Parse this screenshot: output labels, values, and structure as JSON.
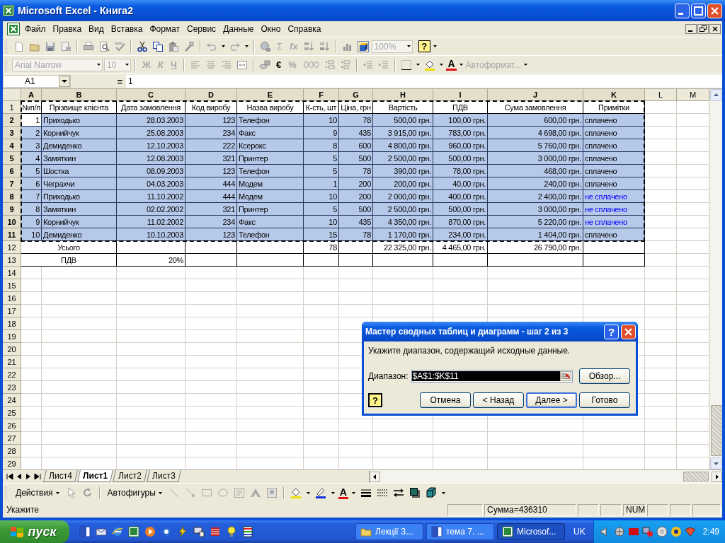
{
  "window": {
    "title": "Microsoft Excel - Книга2"
  },
  "menu": [
    "Файл",
    "Правка",
    "Вид",
    "Вставка",
    "Формат",
    "Сервис",
    "Данные",
    "Окно",
    "Справка"
  ],
  "standard_toolbar": {
    "sum": {
      "text": "Σ",
      "disabled": true
    },
    "function": {
      "text": "fx",
      "disabled": true
    },
    "zoom": {
      "text": "100%",
      "disabled": true
    },
    "help": "?"
  },
  "formatting_toolbar": {
    "font": {
      "text": "Arial Narrow",
      "disabled": true
    },
    "size": {
      "text": "10",
      "disabled": true
    },
    "bold": {
      "text": "Ж",
      "disabled": true
    },
    "italic": {
      "text": "К",
      "disabled": true
    },
    "underline": {
      "text": "Ч",
      "disabled": true
    },
    "euro": {
      "text": "€",
      "disabled": false
    },
    "percent": {
      "text": "%",
      "disabled": true
    },
    "thousands": {
      "text": "000",
      "disabled": true
    },
    "font_color": {
      "text": "A",
      "disabled": false
    },
    "autoformat": {
      "text": "Автоформат...",
      "disabled": true
    }
  },
  "formula_bar": {
    "name_box": "A1",
    "equals": "=",
    "value": "1"
  },
  "sheet": {
    "columns": [
      {
        "label": "A",
        "selected": true
      },
      {
        "label": "B",
        "selected": true
      },
      {
        "label": "C",
        "selected": true
      },
      {
        "label": "D",
        "selected": true
      },
      {
        "label": "E",
        "selected": true
      },
      {
        "label": "F",
        "selected": true
      },
      {
        "label": "G",
        "selected": true
      },
      {
        "label": "H",
        "selected": true
      },
      {
        "label": "I",
        "selected": true
      },
      {
        "label": "J",
        "selected": true
      },
      {
        "label": "K",
        "selected": true
      },
      {
        "label": "L",
        "selected": false
      },
      {
        "label": "M",
        "selected": false
      }
    ],
    "rows": [
      {
        "number": "1",
        "kind": "header",
        "selected": false,
        "cells": [
          "№п/п",
          "Прізвище клієнта",
          "Дата замовлення",
          "Код виробу",
          "Назва виробу",
          "К-сть, шт",
          "Ціна, грн",
          "Вартість",
          "ПДВ",
          "Сума замовлення",
          "Примітки"
        ]
      },
      {
        "number": "2",
        "kind": "data",
        "selected": true,
        "cells": [
          {
            "text": "1",
            "active": true
          },
          "Приходько",
          "28.03.2003",
          "123",
          "Телефон",
          "10",
          "78",
          "500,00 грн.",
          "100,00 грн.",
          "600,00 грн.",
          "сплачено"
        ]
      },
      {
        "number": "3",
        "kind": "data",
        "selected": true,
        "cells": [
          "2",
          "Корнийчук",
          "25.08.2003",
          "234",
          "Факс",
          "9",
          "435",
          "3 915,00 грн.",
          "783,00 грн.",
          "4 698,00 грн.",
          "сплачено"
        ]
      },
      {
        "number": "4",
        "kind": "data",
        "selected": true,
        "cells": [
          "3",
          "Демиденко",
          "12.10.2003",
          "222",
          "Ксерокс",
          "8",
          "600",
          "4 800,00 грн.",
          "960,00 грн.",
          "5 760,00 грн.",
          "сплачено"
        ]
      },
      {
        "number": "5",
        "kind": "data",
        "selected": true,
        "cells": [
          "4",
          "Замяткин",
          "12.08.2003",
          "321",
          "Принтер",
          "5",
          "500",
          "2 500,00 грн.",
          "500,00 грн.",
          "3 000,00 грн.",
          "сплачено"
        ]
      },
      {
        "number": "6",
        "kind": "data",
        "selected": true,
        "cells": [
          "5",
          "Шостка",
          "08.09.2003",
          "123",
          "Телефон",
          "5",
          "78",
          "390,00 грн.",
          "78,00 грн.",
          "468,00 грн.",
          "сплачено"
        ]
      },
      {
        "number": "7",
        "kind": "data",
        "selected": true,
        "cells": [
          "6",
          "Чеграхчи",
          "04.03.2003",
          "444",
          "Модем",
          "1",
          "200",
          "200,00 грн.",
          "40,00 грн.",
          "240,00 грн.",
          "сплачено"
        ]
      },
      {
        "number": "8",
        "kind": "data",
        "selected": true,
        "cells": [
          "7",
          "Приходько",
          "11.10.2002",
          "444",
          "Модем",
          "10",
          "200",
          "2 000,00 грн.",
          "400,00 грн.",
          "2 400,00 грн.",
          {
            "text": "не сплачено",
            "color": "#0000ff"
          }
        ]
      },
      {
        "number": "9",
        "kind": "data",
        "selected": true,
        "cells": [
          "8",
          "Замяткин",
          "02.02.2002",
          "321",
          "Принтер",
          "5",
          "500",
          "2 500,00 грн.",
          "500,00 грн.",
          "3 000,00 грн.",
          {
            "text": "не сплачено",
            "color": "#0000ff"
          }
        ]
      },
      {
        "number": "10",
        "kind": "data",
        "selected": true,
        "cells": [
          "9",
          "Корнийчук",
          "11.02.2002",
          "234",
          "Факс",
          "10",
          "435",
          "4 350,00 грн.",
          "870,00 грн.",
          "5 220,00 грн.",
          {
            "text": "не сплачено",
            "color": "#0000ff"
          }
        ]
      },
      {
        "number": "11",
        "kind": "data",
        "selected": true,
        "cells": [
          "10",
          "Демиденко",
          "10.10.2003",
          "123",
          "Телефон",
          "15",
          "78",
          "1 170,00 грн.",
          "234,00 грн.",
          "1 404,00 грн.",
          "сплачено"
        ]
      },
      {
        "number": "12",
        "kind": "total",
        "selected": false,
        "cells": [
          {
            "text": "Усього",
            "merged": true
          },
          null,
          null,
          null,
          "78",
          null,
          "22 325,00 грн.",
          "4 465,00 грн.",
          "26 790,00 грн.",
          null
        ]
      },
      {
        "number": "13",
        "kind": "total",
        "selected": false,
        "cells": [
          {
            "text": "ПДВ",
            "merged": true
          },
          "20%",
          null,
          null,
          null,
          null,
          null,
          null,
          null,
          null
        ]
      },
      {
        "number": "14",
        "kind": "empty",
        "selected": false
      },
      {
        "number": "15",
        "kind": "empty",
        "selected": false
      },
      {
        "number": "16",
        "kind": "empty",
        "selected": false
      },
      {
        "number": "17",
        "kind": "empty",
        "selected": false
      },
      {
        "number": "18",
        "kind": "empty",
        "selected": false
      },
      {
        "number": "19",
        "kind": "empty",
        "selected": false
      },
      {
        "number": "20",
        "kind": "empty",
        "selected": false
      },
      {
        "number": "21",
        "kind": "empty",
        "selected": false
      },
      {
        "number": "22",
        "kind": "empty",
        "selected": false
      },
      {
        "number": "23",
        "kind": "empty",
        "selected": false
      },
      {
        "number": "24",
        "kind": "empty",
        "selected": false
      },
      {
        "number": "25",
        "kind": "empty",
        "selected": false
      },
      {
        "number": "26",
        "kind": "empty",
        "selected": false
      },
      {
        "number": "27",
        "kind": "empty",
        "selected": false
      },
      {
        "number": "28",
        "kind": "empty",
        "selected": false
      },
      {
        "number": "29",
        "kind": "empty",
        "selected": false
      }
    ]
  },
  "sheet_tabs": [
    {
      "label": "Лист4",
      "selected": false
    },
    {
      "label": "Лист1",
      "selected": true
    },
    {
      "label": "Лист2",
      "selected": false
    },
    {
      "label": "Лист3",
      "selected": false
    }
  ],
  "drawing_toolbar": {
    "actions": "Действия",
    "autoshapes": "Автофигуры",
    "font_color": "A"
  },
  "status_bar": {
    "mode": "Укажите",
    "sum": "Сумма=436310",
    "num": "NUM"
  },
  "dialog": {
    "title": "Мастер сводных таблиц и диаграмм - шаг 2 из 3",
    "help": "?",
    "instruction": "Укажите диапазон, содержащий исходные данные.",
    "range_label": "Диапазон:",
    "range_value": {
      "text": "$A$1:$K$11",
      "selected": true
    },
    "browse": "Обзор...",
    "help_button": "?",
    "buttons": [
      {
        "label": "Отмена",
        "default": false
      },
      {
        "label": "< Назад",
        "default": false
      },
      {
        "label": "Далее >",
        "default": true
      },
      {
        "label": "Готово",
        "default": false
      }
    ]
  },
  "taskbar": {
    "start": "пуск",
    "tasks": [
      {
        "label": "Лекції З...",
        "selected": false
      },
      {
        "label": "тема 7. ...",
        "selected": false
      },
      {
        "label": "Microsof...",
        "selected": true
      }
    ],
    "language": "UK",
    "clock": "2:49"
  }
}
